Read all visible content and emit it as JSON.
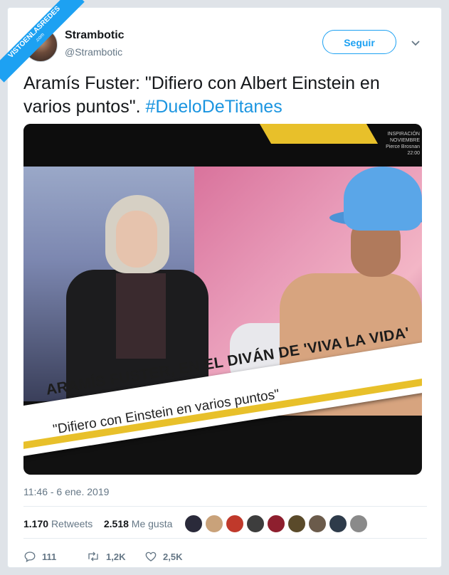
{
  "watermark": {
    "line1": "VISTOENLASREDES",
    "line2": ".com"
  },
  "user": {
    "name": "Strambotic",
    "handle": "@Strambotic"
  },
  "follow_label": "Seguir",
  "tweet": {
    "text": "Aramís Fuster: \"Difiero con Albert Einstein en varios puntos\". ",
    "hashtag": "#DueloDeTitanes"
  },
  "media": {
    "promo_line1": "INSPIRACIÓN",
    "promo_line2": "NOVIEMBRE",
    "promo_line3": "Pierce Brosnan",
    "promo_line4": "22:00",
    "headline": "ARAMÍS FUSTER, EN EL DIVÁN DE 'VIVA LA VIDA'",
    "quote": "\"Difiero con Einstein en varios puntos\""
  },
  "timestamp": "11:46 - 6 ene. 2019",
  "stats": {
    "retweets_count": "1.170",
    "retweets_label": "Retweets",
    "likes_count": "2.518",
    "likes_label": "Me gusta"
  },
  "actions": {
    "replies": "111",
    "retweets": "1,2K",
    "likes": "2,5K"
  },
  "colors": {
    "accent": "#1da1f2",
    "hashtag": "#1b95e0",
    "muted": "#657786"
  },
  "icons": {
    "reply": "reply-icon",
    "retweet": "retweet-icon",
    "like": "heart-icon",
    "menu": "chevron-down-icon"
  }
}
